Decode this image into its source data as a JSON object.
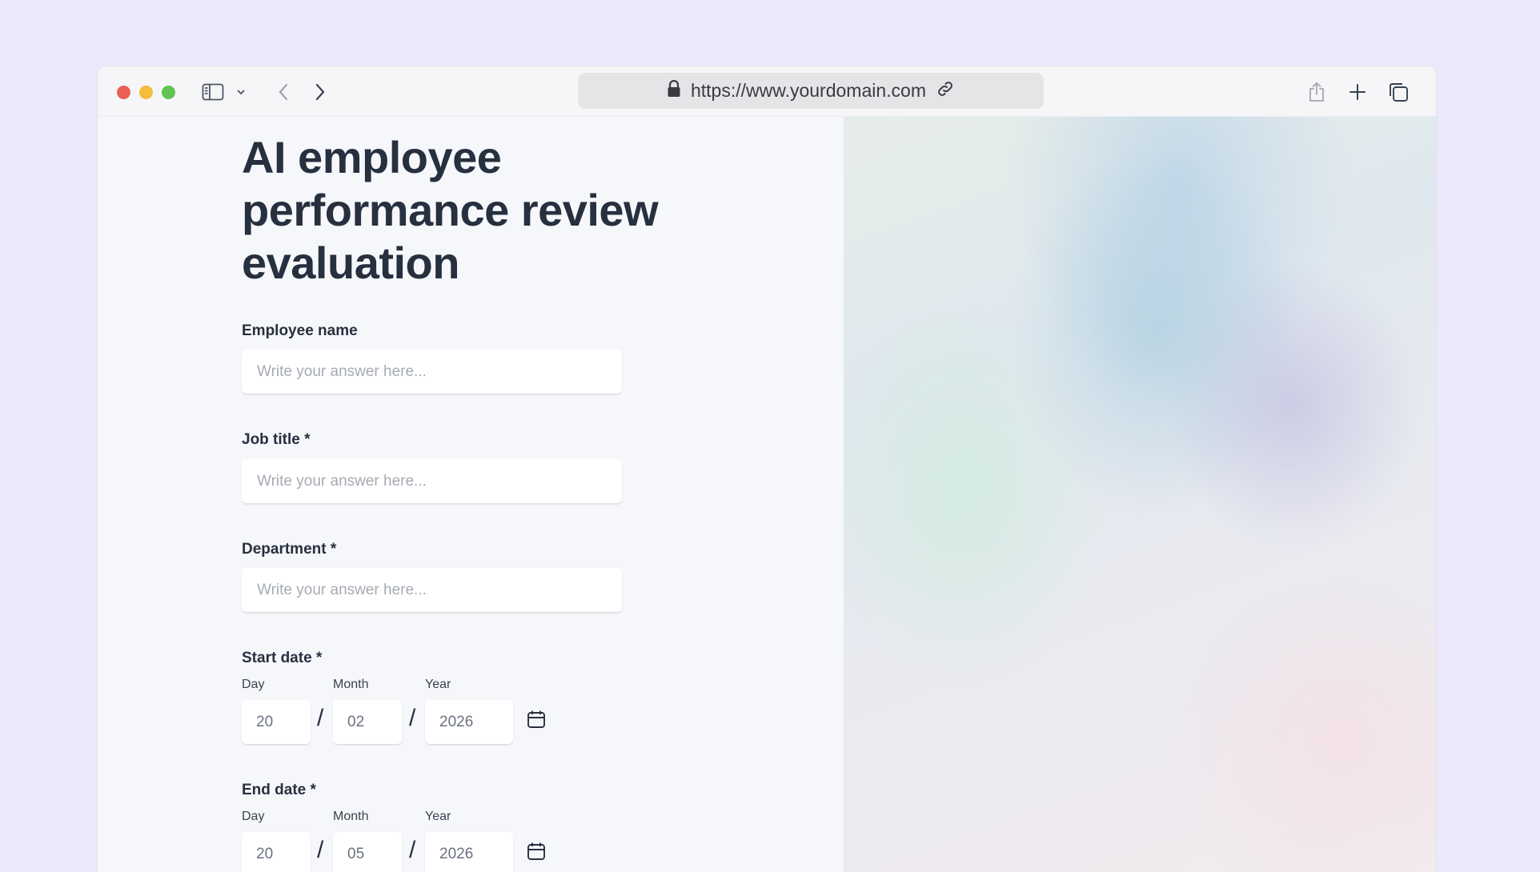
{
  "browser": {
    "url": "https://www.yourdomain.com"
  },
  "form": {
    "title": "AI employee performance review evaluation",
    "employee_name": {
      "label": "Employee name",
      "placeholder": "Write your answer here..."
    },
    "job_title": {
      "label": "Job title *",
      "placeholder": "Write your answer here..."
    },
    "department": {
      "label": "Department *",
      "placeholder": "Write your answer here..."
    },
    "start_date": {
      "label": "Start date *",
      "day_label": "Day",
      "month_label": "Month",
      "year_label": "Year",
      "day": "20",
      "month": "02",
      "year": "2026",
      "separator": "/"
    },
    "end_date": {
      "label": "End date *",
      "day_label": "Day",
      "month_label": "Month",
      "year_label": "Year",
      "day": "20",
      "month": "05",
      "year": "2026",
      "separator": "/"
    }
  },
  "icons": {
    "lock": "lock-icon",
    "link": "link-icon",
    "calendar": "calendar-icon"
  },
  "colors": {
    "page_background": "#ece9fb",
    "heading": "#27303f",
    "placeholder": "#a6abb3"
  }
}
